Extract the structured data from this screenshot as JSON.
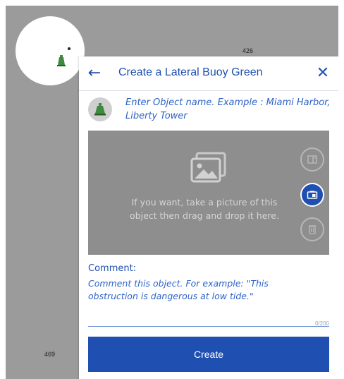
{
  "map": {
    "depth_top": "426",
    "depth_bottom": "469",
    "marker_icon": "buoy-green-icon"
  },
  "header": {
    "back_icon": "arrow-left-icon",
    "title": "Create a Lateral Buoy Green",
    "close_icon": "close-icon"
  },
  "object": {
    "avatar_icon": "buoy-green-icon",
    "name_placeholder": "Enter Object name. Example : Miami Harbor, Liberty Tower"
  },
  "photo": {
    "image_icon": "image-icon",
    "instructions": "If you want, take a picture of this object then drag and drop it here.",
    "actions": [
      {
        "icon": "gallery-icon",
        "active": false
      },
      {
        "icon": "camera-icon",
        "active": true
      },
      {
        "icon": "trash-icon",
        "active": false
      }
    ]
  },
  "comment": {
    "label": "Comment:",
    "placeholder": "Comment this object. For example: \"This obstruction is dangerous at low tide.\"",
    "counter": "0/200"
  },
  "create_label": "Create",
  "colors": {
    "accent": "#1f4fb0",
    "placeholder_text": "#2d62c7",
    "map_background": "#9b9b9b",
    "dropzone_background": "#8e8e8e",
    "buoy_green": "#3e8a3e"
  }
}
